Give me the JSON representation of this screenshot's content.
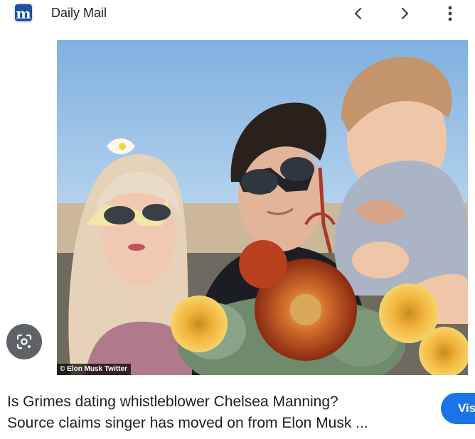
{
  "header": {
    "favicon_letter": "m",
    "source_name": "Daily Mail"
  },
  "icons": {
    "prev": "chevron-left-icon",
    "next": "chevron-right-icon",
    "more": "more-vert-icon",
    "lens": "lens-icon"
  },
  "image": {
    "credit": "© Elon Musk Twitter"
  },
  "caption": {
    "line1": "Is Grimes dating whistleblower Chelsea Manning?",
    "line2": "Source claims singer has moved on from Elon Musk ..."
  },
  "visit_button": {
    "label": "Visit"
  },
  "colors": {
    "brand": "#1f4fa3",
    "accent": "#1a73e8",
    "lens_button": "#5f6368"
  }
}
